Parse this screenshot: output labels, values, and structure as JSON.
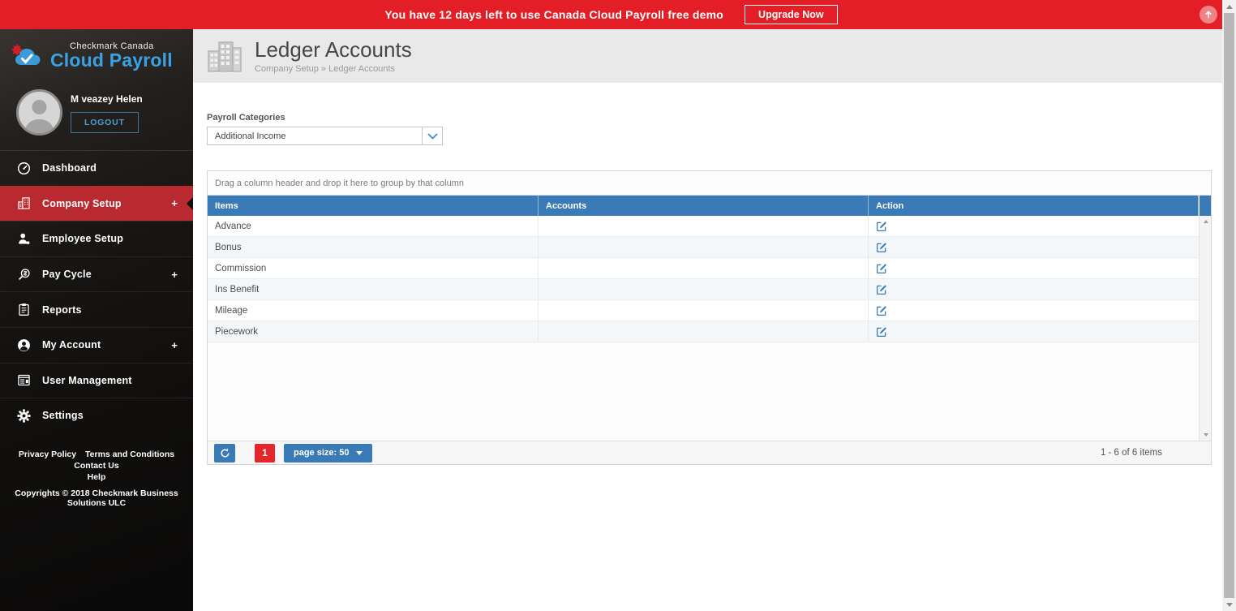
{
  "banner": {
    "message": "You have 12 days left to use Canada Cloud Payroll free demo",
    "upgrade_label": "Upgrade Now"
  },
  "sidebar": {
    "brand": {
      "top": "Checkmark Canada",
      "name": "Cloud Payroll"
    },
    "user": {
      "name": "M veazey Helen",
      "logout_label": "LOGOUT"
    },
    "nav": [
      {
        "label": "Dashboard",
        "icon": "dashboard-icon"
      },
      {
        "label": "Company Setup",
        "icon": "company-setup-icon",
        "plus": "+",
        "active": true
      },
      {
        "label": "Employee Setup",
        "icon": "employee-setup-icon"
      },
      {
        "label": "Pay Cycle",
        "icon": "pay-cycle-icon",
        "plus": "+"
      },
      {
        "label": "Reports",
        "icon": "reports-icon"
      },
      {
        "label": "My Account",
        "icon": "my-account-icon",
        "plus": "+"
      },
      {
        "label": "User Management",
        "icon": "user-management-icon"
      },
      {
        "label": "Settings",
        "icon": "settings-icon"
      }
    ],
    "footer_links": [
      "Privacy Policy",
      "Terms and Conditions",
      "Contact Us",
      "Help"
    ],
    "copyright": "Copyrights © 2018 Checkmark Business Solutions ULC"
  },
  "header": {
    "title": "Ledger Accounts",
    "breadcrumb": "Company Setup » Ledger Accounts"
  },
  "filters": {
    "label": "Payroll Categories",
    "selected": "Additional Income"
  },
  "grid": {
    "group_hint": "Drag a column header and drop it here to group by that column",
    "columns": [
      "Items",
      "Accounts",
      "Action"
    ],
    "rows": [
      {
        "item": "Advance",
        "account": ""
      },
      {
        "item": "Bonus",
        "account": ""
      },
      {
        "item": "Commission",
        "account": ""
      },
      {
        "item": "Ins Benefit",
        "account": ""
      },
      {
        "item": "Mileage",
        "account": ""
      },
      {
        "item": "Piecework",
        "account": ""
      }
    ],
    "pager": {
      "page": "1",
      "page_size_label": "page size: 50",
      "info": "1 - 6 of 6 items"
    }
  },
  "icons": {
    "scroll_top": "up-arrow-circle-icon",
    "refresh": "refresh-icon",
    "edit": "edit-icon",
    "dropdown": "chevron-down-icon"
  },
  "colors": {
    "banner_red": "#e31e26",
    "active_nav_red": "#b92a30",
    "page_button_red": "#e2262c",
    "grid_header_blue": "#3a7ab7",
    "logo_blue": "#3aa2e4",
    "logout_blue": "#4aa0d4",
    "header_band_gray": "#e9e9e9",
    "row_alt": "#f4f7f9"
  }
}
